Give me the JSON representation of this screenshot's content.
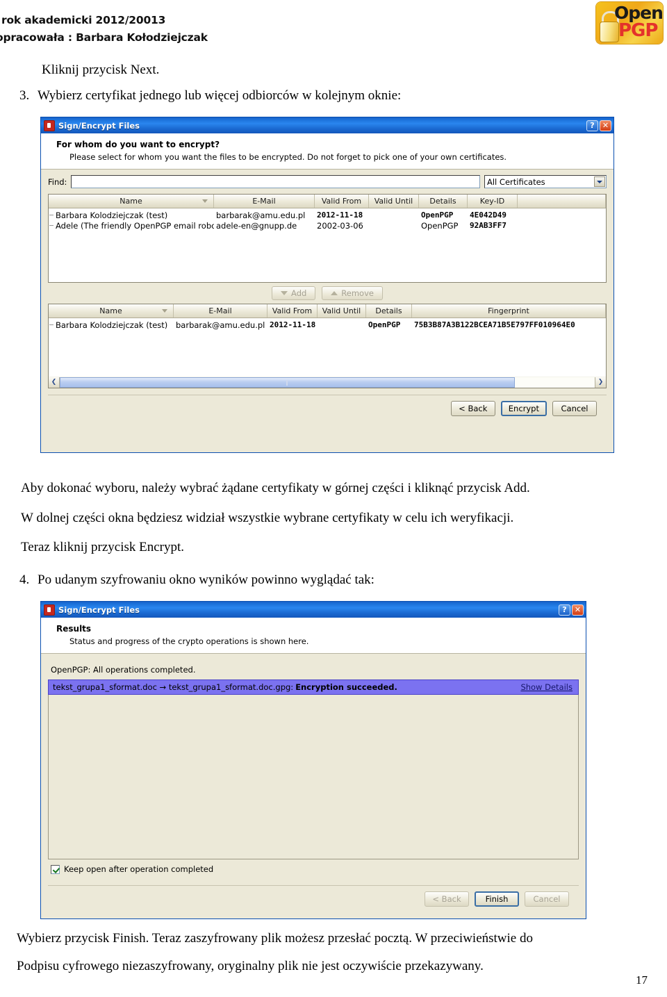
{
  "header": {
    "line1": "rok akademicki 2012/20013",
    "line2": "opracowała : Barbara Kołodziejczak",
    "logo": {
      "open_text": "Open-",
      "pgp_text": "PGP",
      "bg_color": "#f0a81a",
      "pgp_color": "#e4322b"
    }
  },
  "content": {
    "intro": "Kliknij przycisk Next.",
    "step3": {
      "number": "3.",
      "text": "Wybierz certyfikat jednego lub więcej odbiorców w kolejnym oknie:"
    },
    "para1": "Aby dokonać wyboru, należy wybrać żądane certyfikaty w górnej części i kliknąć przycisk Add.",
    "para2": "W dolnej części okna będziesz widział wszystkie wybrane certyfikaty w celu ich weryfikacji.",
    "para3": "Teraz kliknij przycisk Encrypt.",
    "step4": {
      "number": "4.",
      "text": "Po udanym szyfrowaniu okno wyników powinno wyglądać tak:"
    },
    "closing1": "Wybierz przycisk Finish. Teraz zaszyfrowany plik możesz przesłać pocztą. W przeciwieństwie do",
    "closing2": "Podpisu cyfrowego niezaszyfrowany,  oryginalny plik nie jest oczywiście przekazywany.",
    "page_number": "17"
  },
  "dialog1": {
    "title": "Sign/Encrypt Files",
    "titlebar_icon": "app-icon",
    "help_button": "?",
    "close_button": "✕",
    "heading": "For whom do you want to encrypt?",
    "subheading": "Please select for whom you want the files to be encrypted. Do not forget to pick one of your own certificates.",
    "find": {
      "label": "Find:",
      "value": "",
      "placeholder": ""
    },
    "filter_select": {
      "value": "All Certificates"
    },
    "upper_table": {
      "columns": [
        "Name",
        "E-Mail",
        "Valid From",
        "Valid Until",
        "Details",
        "Key-ID"
      ],
      "sorted_column": "Name",
      "rows": [
        {
          "name": "Barbara Kolodziejczak (test)",
          "email": "barbarak@amu.edu.pl",
          "valid_from": "2012-11-18",
          "valid_until": "",
          "details": "OpenPGP",
          "key_id": "4E042D49"
        },
        {
          "name": "Adele (The friendly OpenPGP email robot)",
          "email": "adele-en@gnupp.de",
          "valid_from": "2002-03-06",
          "valid_until": "",
          "details": "OpenPGP",
          "key_id": "92AB3FF7"
        }
      ]
    },
    "add_button": "Add",
    "remove_button": "Remove",
    "lower_table": {
      "columns": [
        "Name",
        "E-Mail",
        "Valid From",
        "Valid Until",
        "Details",
        "Fingerprint"
      ],
      "sorted_column": "Name",
      "rows": [
        {
          "name": "Barbara Kolodziejczak (test)",
          "email": "barbarak@amu.edu.pl",
          "valid_from": "2012-11-18",
          "valid_until": "",
          "details": "OpenPGP",
          "fingerprint": "75B3B87A3B122BCEA71B5E797FF010964E0"
        }
      ]
    },
    "scrollbar": {
      "left_arrow": "❮",
      "right_arrow": "❯"
    },
    "buttons": {
      "back": "< Back",
      "encrypt": "Encrypt",
      "cancel": "Cancel"
    }
  },
  "dialog2": {
    "title": "Sign/Encrypt Files",
    "help_button": "?",
    "close_button": "✕",
    "heading": "Results",
    "subheading": "Status and progress of the crypto operations is shown here.",
    "status_line": "OpenPGP: All operations completed.",
    "result_item": {
      "files": "tekst_grupa1_sformat.doc → tekst_grupa1_sformat.doc.gpg:",
      "status": "Encryption succeeded.",
      "details_link": "Show Details",
      "highlight_color": "#7b72f0"
    },
    "keep_open_checkbox": {
      "label": "Keep open after operation completed",
      "checked": true
    },
    "buttons": {
      "back": "< Back",
      "finish": "Finish",
      "cancel": "Cancel"
    }
  }
}
